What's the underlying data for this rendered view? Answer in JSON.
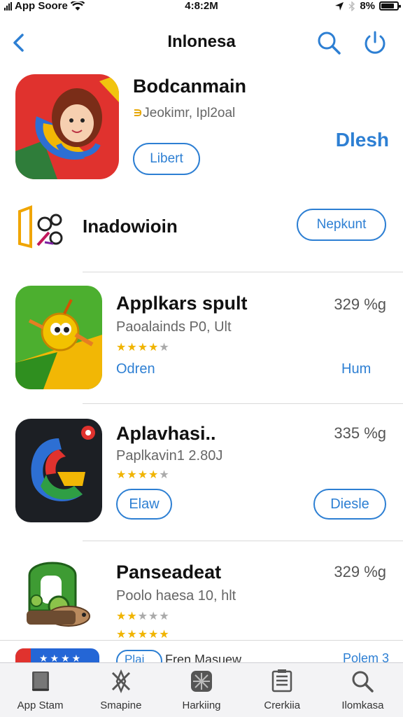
{
  "status": {
    "carrier": "App Soore",
    "time": "4:8:2M",
    "battery": "8%",
    "battery_level": 0.8
  },
  "nav": {
    "title": "Inlonesa"
  },
  "featured": {
    "title": "Bodcanmain",
    "subtitle_mark": "∍",
    "subtitle": "Jeokimr, Ipl2oal",
    "button_label": "Libert",
    "action_label": "Dlesh"
  },
  "section": {
    "title": "Inadowioin",
    "button_label": "Nepkunt"
  },
  "apps": [
    {
      "name": "Applkars spult",
      "size": "329 %g",
      "meta": "Paoalainds P0, Ult",
      "rating": 4,
      "link_left": "Odren",
      "link_right": "Hum"
    },
    {
      "name": "Aplavhasi..",
      "size": "335 %g",
      "meta": "Paplkavin1 2.80J",
      "rating": 4,
      "button_left": "Elaw",
      "button_right": "Diesle"
    },
    {
      "name": "Panseadeat",
      "size": "329 %g",
      "meta": "Poolo haesa 10, hlt",
      "rating": 2,
      "rating_second": 5
    }
  ],
  "peek": {
    "icon_stars": "★★★★",
    "pill_label": "Plai",
    "name": "Fren Masuew",
    "size": "Polem 3"
  },
  "tabs": [
    {
      "label": "App Stam",
      "icon": "book-icon"
    },
    {
      "label": "Smapine",
      "icon": "compass-icon"
    },
    {
      "label": "Harkiing",
      "icon": "grid-icon"
    },
    {
      "label": "Crerkiia",
      "icon": "list-icon"
    },
    {
      "label": "Ilomkasa",
      "icon": "search-icon"
    }
  ],
  "colors": {
    "accent": "#2d7fd3",
    "star": "#f0b400"
  }
}
